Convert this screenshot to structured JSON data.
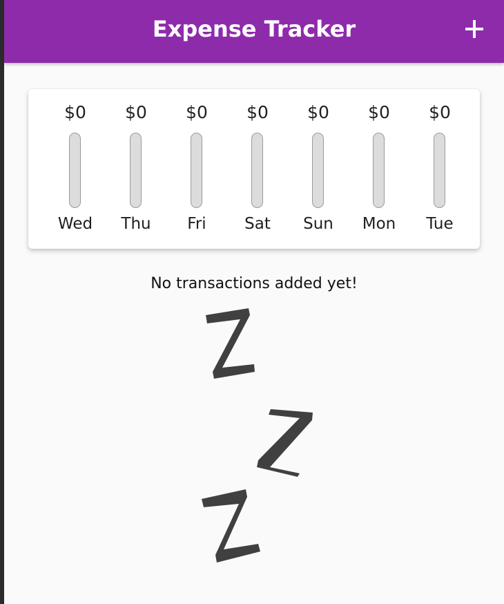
{
  "app": {
    "title": "Expense Tracker",
    "brand_color": "#8e2bab"
  },
  "actions": {
    "add_icon": "plus-icon"
  },
  "chart": {
    "bars": [
      {
        "day": "Wed",
        "amount": "$0",
        "fraction": 0
      },
      {
        "day": "Thu",
        "amount": "$0",
        "fraction": 0
      },
      {
        "day": "Fri",
        "amount": "$0",
        "fraction": 0
      },
      {
        "day": "Sat",
        "amount": "$0",
        "fraction": 0
      },
      {
        "day": "Sun",
        "amount": "$0",
        "fraction": 0
      },
      {
        "day": "Mon",
        "amount": "$0",
        "fraction": 0
      },
      {
        "day": "Tue",
        "amount": "$0",
        "fraction": 0
      }
    ]
  },
  "empty_state": {
    "message": "No transactions added yet!",
    "illustration": "sleeping-zzz-icon"
  }
}
